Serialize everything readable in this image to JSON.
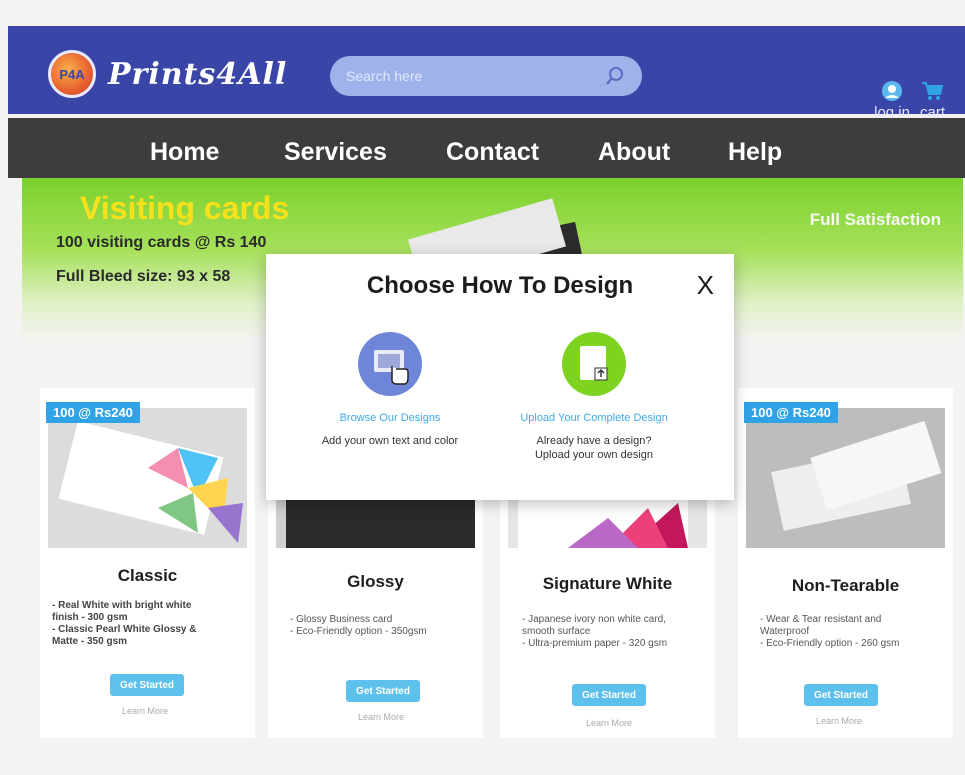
{
  "header": {
    "logo_badge": "P4A",
    "logo_text": "Prints4All",
    "search_placeholder": "Search here",
    "login_label": "log in",
    "cart_label": "cart"
  },
  "nav": {
    "items": [
      "Home",
      "Services",
      "Contact",
      "About",
      "Help"
    ]
  },
  "banner": {
    "title": "Visiting cards",
    "line1": "100 visiting cards @ Rs 140",
    "line2_label": "Full Bleed size:",
    "line2_value": "93 x 58",
    "right_text": "Full Satisfaction"
  },
  "modal": {
    "title": "Choose How To Design",
    "close_label": "X",
    "option1": {
      "link": "Browse Our Designs",
      "desc": "Add your own text and color"
    },
    "option2": {
      "link": "Upload Your Complete Design",
      "desc_line1": "Already have a design?",
      "desc_line2": "Upload your own design"
    }
  },
  "products": [
    {
      "badge": "100 @ Rs240",
      "title": "Classic",
      "desc": [
        "- Real White with bright white",
        "finish - 300 gsm",
        "- Classic Pearl White Glossy &",
        "Matte - 350 gsm"
      ],
      "button": "Get Started",
      "link": "Learn More"
    },
    {
      "badge": "",
      "title": "Glossy",
      "desc": [
        "- Glossy Business card",
        "- Eco-Friendly option - 350gsm"
      ],
      "button": "Get Started",
      "link": "Learn More"
    },
    {
      "badge": "",
      "title": "Signature White",
      "desc": [
        "- Japanese ivory non white card,",
        "smooth surface",
        "- Ultra-premium paper - 320 gsm"
      ],
      "button": "Get Started",
      "link": "Learn More"
    },
    {
      "badge": "100 @ Rs240",
      "title": "Non-Tearable",
      "desc": [
        "- Wear & Tear resistant and",
        "Waterproof",
        "- Eco-Friendly option - 260 gsm"
      ],
      "button": "Get Started",
      "link": "Learn More"
    }
  ],
  "colors": {
    "header_bg": "#3a45a8",
    "nav_bg": "#3d3d3d",
    "banner_green": "#7bd12c",
    "badge_blue": "#2fa3e6",
    "button_blue": "#5ec0ec",
    "option1_circle": "#6f86d8",
    "option2_circle": "#7ed321"
  }
}
